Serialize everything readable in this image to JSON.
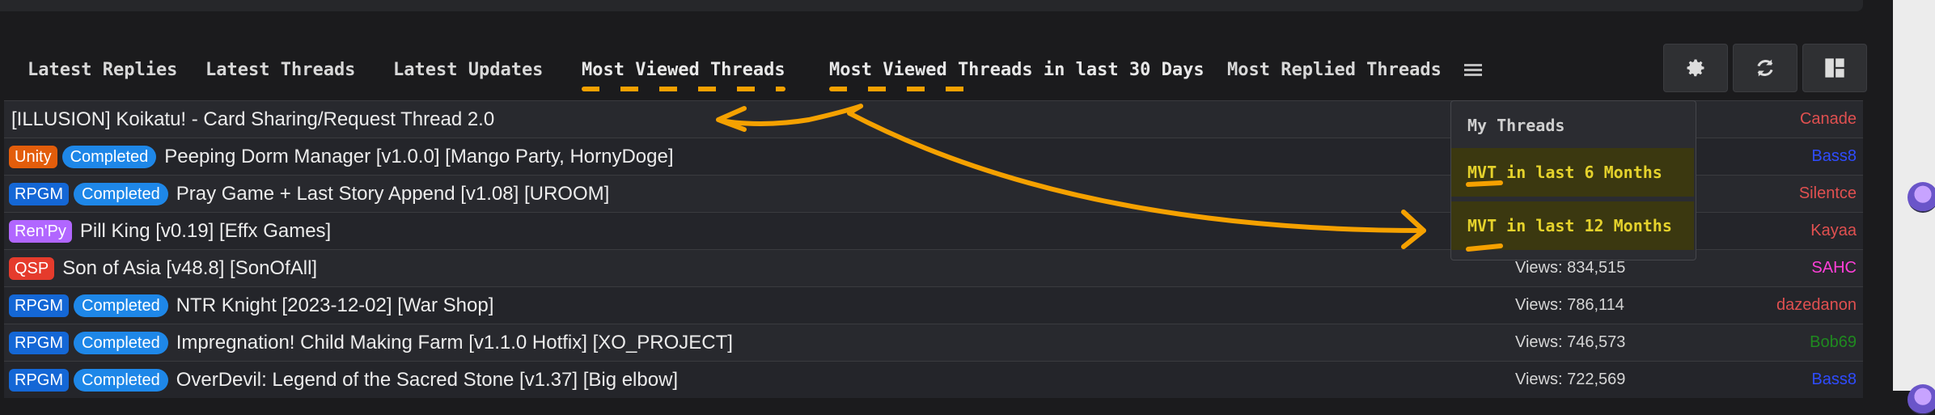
{
  "tabs": [
    {
      "label": "Latest Replies"
    },
    {
      "label": "Latest Threads"
    },
    {
      "label": "Latest Updates"
    },
    {
      "label": "Most Viewed Threads"
    },
    {
      "label": "Most Viewed Threads in last 30 Days"
    },
    {
      "label": "Most Replied Threads"
    }
  ],
  "toolbar": {
    "icons": [
      "gear-icon",
      "refresh-icon",
      "layout-icon"
    ]
  },
  "dropdown": {
    "header": "My Threads",
    "items": [
      {
        "label": "MVT in last 6 Months"
      },
      {
        "label": "MVT in last 12 Months"
      }
    ]
  },
  "threads": [
    {
      "badges": [],
      "title": "[ILLUSION] Koikatu! - Card Sharing/Request Thread 2.0",
      "views": "",
      "author": "Canade"
    },
    {
      "badges": [
        "Unity",
        "Completed"
      ],
      "title": "Peeping Dorm Manager [v1.0.0] [Mango Party, HornyDoge]",
      "views": "",
      "author": "Bass8"
    },
    {
      "badges": [
        "RPGM",
        "Completed"
      ],
      "title": "Pray Game + Last Story Append [v1.08] [UROOM]",
      "views": "",
      "author": "Silentce"
    },
    {
      "badges": [
        "Ren'Py"
      ],
      "title": "Pill King [v0.19] [Effx Games]",
      "views": "",
      "author": "Kayaa"
    },
    {
      "badges": [
        "QSP"
      ],
      "title": "Son of Asia [v48.8] [SonOfAll]",
      "views": "Views: 834,515",
      "author": "SAHC"
    },
    {
      "badges": [
        "RPGM",
        "Completed"
      ],
      "title": "NTR Knight [2023-12-02] [War Shop]",
      "views": "Views: 786,114",
      "author": "dazedanon"
    },
    {
      "badges": [
        "RPGM",
        "Completed"
      ],
      "title": "Impregnation! Child Making Farm [v1.1.0 Hotfix] [XO_PROJECT]",
      "views": "Views: 746,573",
      "author": "Bob69"
    },
    {
      "badges": [
        "RPGM",
        "Completed"
      ],
      "title": "OverDevil: Legend of the Sacred Stone [v1.37] [Big elbow]",
      "views": "Views: 722,569",
      "author": "Bass8"
    }
  ],
  "colors": {
    "annotation": "#f5a100",
    "author_red": "#e05050",
    "author_blue": "#2f4cff",
    "author_green": "#1f8a1f",
    "author_pink": "#ff3fd8"
  }
}
